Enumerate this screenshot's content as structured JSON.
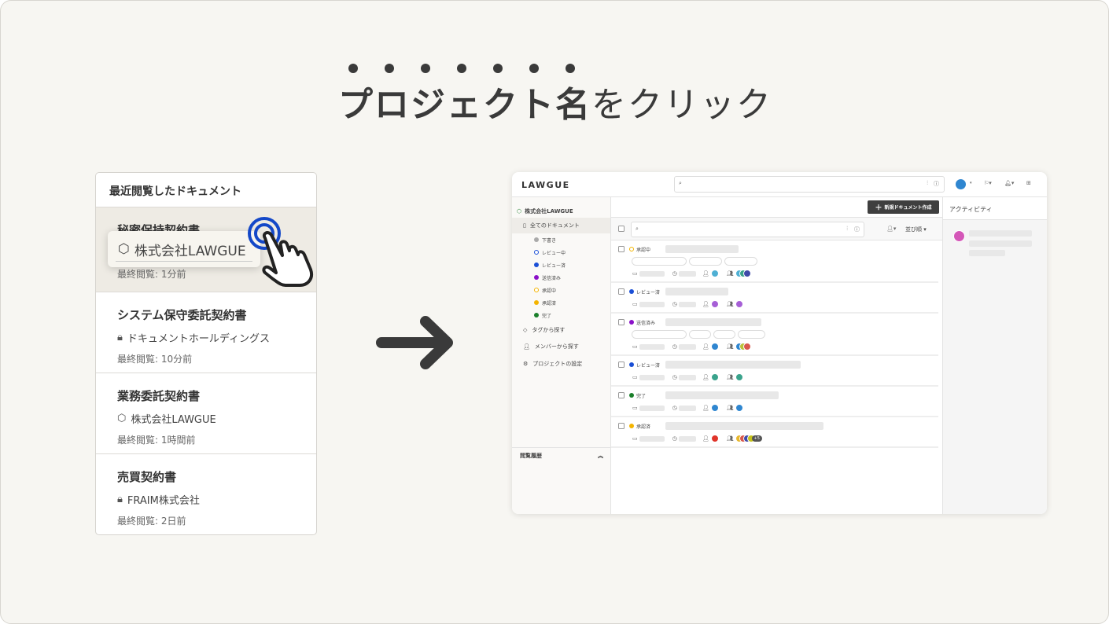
{
  "headline": {
    "bold": "プロジェクト名",
    "light": "をクリック"
  },
  "recent": {
    "title": "最近閲覧したドキュメント",
    "popup_project": "株式会社LAWGUE",
    "docs": [
      {
        "name": "秘密保持契約書",
        "project": "株式会社LAWGUE",
        "icon": "cube-icon",
        "viewed": "最終閲覧: 1分前"
      },
      {
        "name": "システム保守委託契約書",
        "project": "ドキュメントホールディングス",
        "icon": "lock-icon",
        "viewed": "最終閲覧: 10分前"
      },
      {
        "name": "業務委託契約書",
        "project": "株式会社LAWGUE",
        "icon": "cube-icon",
        "viewed": "最終閲覧: 1時間前"
      },
      {
        "name": "売買契約書",
        "project": "FRAIM株式会社",
        "icon": "lock-icon",
        "viewed": "最終閲覧: 2日前"
      }
    ]
  },
  "app": {
    "logo": "LAWGUE",
    "org": "株式会社LAWGUE",
    "all_docs": "全てのドキュメント",
    "statuses": [
      {
        "label": "下書き",
        "color": "#aaaaaa",
        "hollow": false
      },
      {
        "label": "レビュー中",
        "color": "#1a4fd6",
        "hollow": true
      },
      {
        "label": "レビュー済",
        "color": "#1a4fd6",
        "hollow": false
      },
      {
        "label": "送信済み",
        "color": "#8a10c8",
        "hollow": false
      },
      {
        "label": "承認中",
        "color": "#f4b400",
        "hollow": true
      },
      {
        "label": "承認済",
        "color": "#f4b400",
        "hollow": false
      },
      {
        "label": "完了",
        "color": "#1a7f2a",
        "hollow": false
      }
    ],
    "nav": [
      {
        "label": "タグから探す",
        "icon": "tag-icon"
      },
      {
        "label": "メンバーから探す",
        "icon": "user-icon"
      },
      {
        "label": "プロジェクトの設定",
        "icon": "gear-icon"
      }
    ],
    "history": "閲覧履歴",
    "new_button": "新規ドキュメント作成",
    "sort": "並び順",
    "activity": "アクティビティ",
    "activity_avatar": "#d457b8",
    "user_avatar": "#2f86d0",
    "rows": [
      {
        "status": "承認中",
        "color": "#f4b400",
        "hollow": true,
        "pills": [
          5,
          3,
          3
        ],
        "owner": "#4fb0d4",
        "members": [
          "#4fb0d4",
          "#3aa38c",
          "#3f4aa8"
        ]
      },
      {
        "status": "レビュー済",
        "color": "#1a4fd6",
        "hollow": false,
        "pills": [],
        "owner": "#a65fd6",
        "members": [
          "#a65fd6"
        ]
      },
      {
        "status": "送信済み",
        "color": "#8a10c8",
        "hollow": false,
        "pills": [
          5,
          2,
          2,
          2.5
        ],
        "owner": "#2f86d0",
        "members": [
          "#2f86d0",
          "#b9c23a",
          "#d9584c"
        ]
      },
      {
        "status": "レビュー済",
        "color": "#1a4fd6",
        "hollow": false,
        "pills": [],
        "owner": "#3aa38c",
        "members": [
          "#3aa38c"
        ]
      },
      {
        "status": "完了",
        "color": "#1a7f2a",
        "hollow": false,
        "pills": [],
        "owner": "#2f86d0",
        "members": [
          "#2f86d0"
        ]
      },
      {
        "status": "承認済",
        "color": "#f4b400",
        "hollow": false,
        "pills": [],
        "owner": "#e0342a",
        "members": [
          "#e8b82e",
          "#d9584c",
          "#3f4aa8",
          "#c6c21c"
        ],
        "more": "+5"
      }
    ]
  }
}
